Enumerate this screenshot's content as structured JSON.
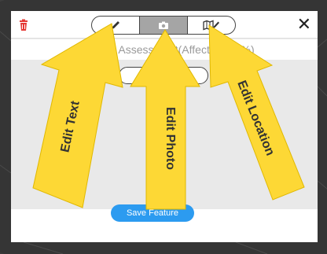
{
  "toolbar": {
    "delete_icon": "trash-icon",
    "close_label": "✕",
    "modes": [
      {
        "icon": "pencil-icon",
        "selected": false
      },
      {
        "icon": "camera-icon",
        "selected": true
      },
      {
        "icon": "map-pencil-icon",
        "selected": false
      }
    ]
  },
  "form": {
    "title": "Damage Assessment(Affected 1-9%)"
  },
  "footer": {
    "save_label": "Save Feature"
  },
  "annotations": {
    "edit_text": "Edit Text",
    "edit_photo": "Edit Photo",
    "edit_location": "Edit Location"
  },
  "colors": {
    "accent": "#2c9bf0",
    "arrow_fill": "#fdd835",
    "delete": "#e53935"
  }
}
